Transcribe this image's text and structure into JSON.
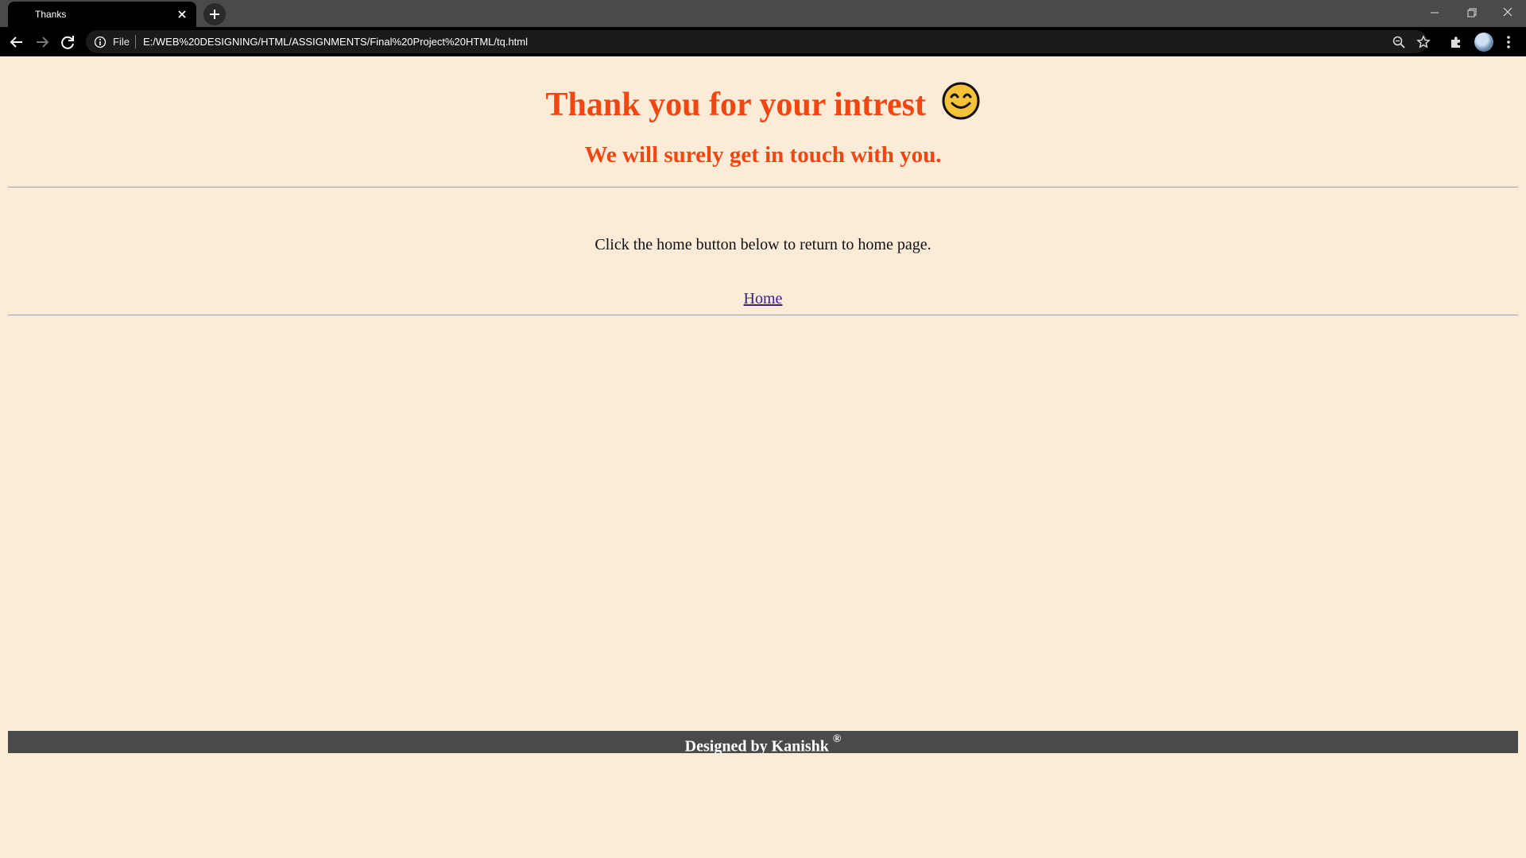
{
  "browser": {
    "tab_title": "Thanks",
    "address_scheme_label": "File",
    "url": "E:/WEB%20DESIGNING/HTML/ASSIGNMENTS/Final%20Project%20HTML/tq.html"
  },
  "page": {
    "heading": "Thank you for your intrest",
    "subheading": "We will surely get in touch with you.",
    "instruction": "Click the home button below to return to home page.",
    "home_link": "Home",
    "footer_text": "Designed by Kanishk",
    "footer_mark": "®"
  },
  "colors": {
    "page_background": "#fbebd7",
    "heading": "#f24611",
    "link": "#3d1f8c",
    "footer_background": "#4a4a4a"
  }
}
